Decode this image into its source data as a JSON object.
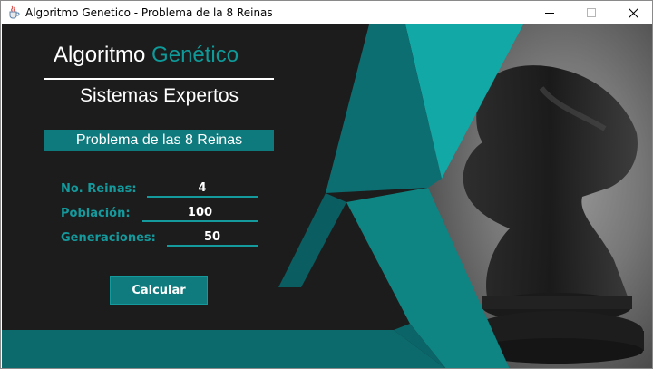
{
  "window": {
    "title": "Algoritmo Genetico - Problema de la 8 Reinas"
  },
  "header": {
    "title_part1": "Algoritmo",
    "title_part2": "Genético",
    "subtitle": "Sistemas Expertos",
    "banner": "Problema de las 8 Reinas"
  },
  "form": {
    "reinas": {
      "label": "No. Reinas:",
      "value": "4"
    },
    "poblacion": {
      "label": "Población:",
      "value": "100"
    },
    "generaciones": {
      "label": "Generaciones:",
      "value": "50"
    }
  },
  "actions": {
    "calcular": "Calcular"
  },
  "colors": {
    "accent": "#0e7a7d",
    "accent_light": "#14999c",
    "background": "#1c1c1c"
  },
  "icons": {
    "app": "java-cup-icon",
    "minimize": "minimize-icon",
    "maximize": "maximize-icon",
    "close": "close-icon",
    "photo": "chess-knight-photo"
  }
}
